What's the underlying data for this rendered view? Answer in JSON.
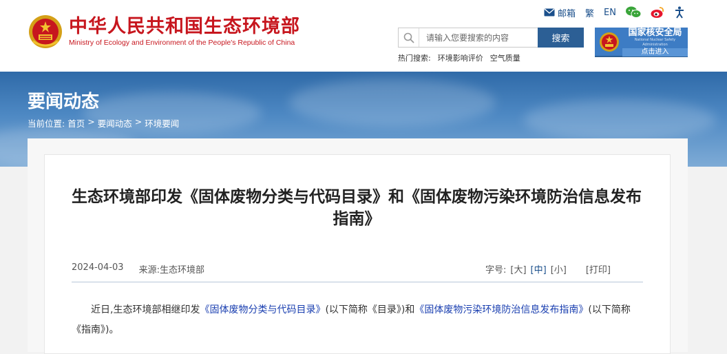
{
  "header": {
    "name_cn": "中华人民共和国生态环境部",
    "name_en": "Ministry of Ecology and Environment of the People's Republic of China",
    "links": {
      "mail": "邮箱",
      "traditional": "繁",
      "english": "EN"
    },
    "icons": [
      "mail-icon",
      "wechat-icon",
      "weibo-icon",
      "accessibility-icon"
    ],
    "search": {
      "placeholder": "请输入您要搜索的内容",
      "button": "搜索"
    },
    "hot": {
      "label": "热门搜索:",
      "items": [
        "环境影响评价",
        "空气质量"
      ]
    },
    "nnsa": {
      "name": "国家核安全局",
      "name_en": "National Nuclear Safety Administration",
      "enter": "点击进入"
    }
  },
  "banner": {
    "title": "要闻动态",
    "breadcrumb": [
      "当前位置:",
      "首页",
      ">",
      "要闻动态",
      ">",
      "环境要闻"
    ]
  },
  "article": {
    "title": "生态环境部印发《固体废物分类与代码目录》和《固体废物污染环境防治信息发布指南》",
    "date": "2024-04-03",
    "source": "来源:生态环境部",
    "font_size": {
      "label": "字号:",
      "large": "[大]",
      "medium": "[中]",
      "small": "[小]"
    },
    "print": "[打印]",
    "para": {
      "p1": "近日,生态环境部相继印发",
      "link1": "《固体废物分类与代码目录》",
      "p2": "(以下简称《目录》)和",
      "link2": "《固体废物污染环境防治信息发布指南》",
      "p3": "(以下简称《指南》)。"
    }
  },
  "colors": {
    "brand_red": "#c7161e",
    "nav_blue": "#2c5f95",
    "link_blue": "#1a3fb0"
  }
}
